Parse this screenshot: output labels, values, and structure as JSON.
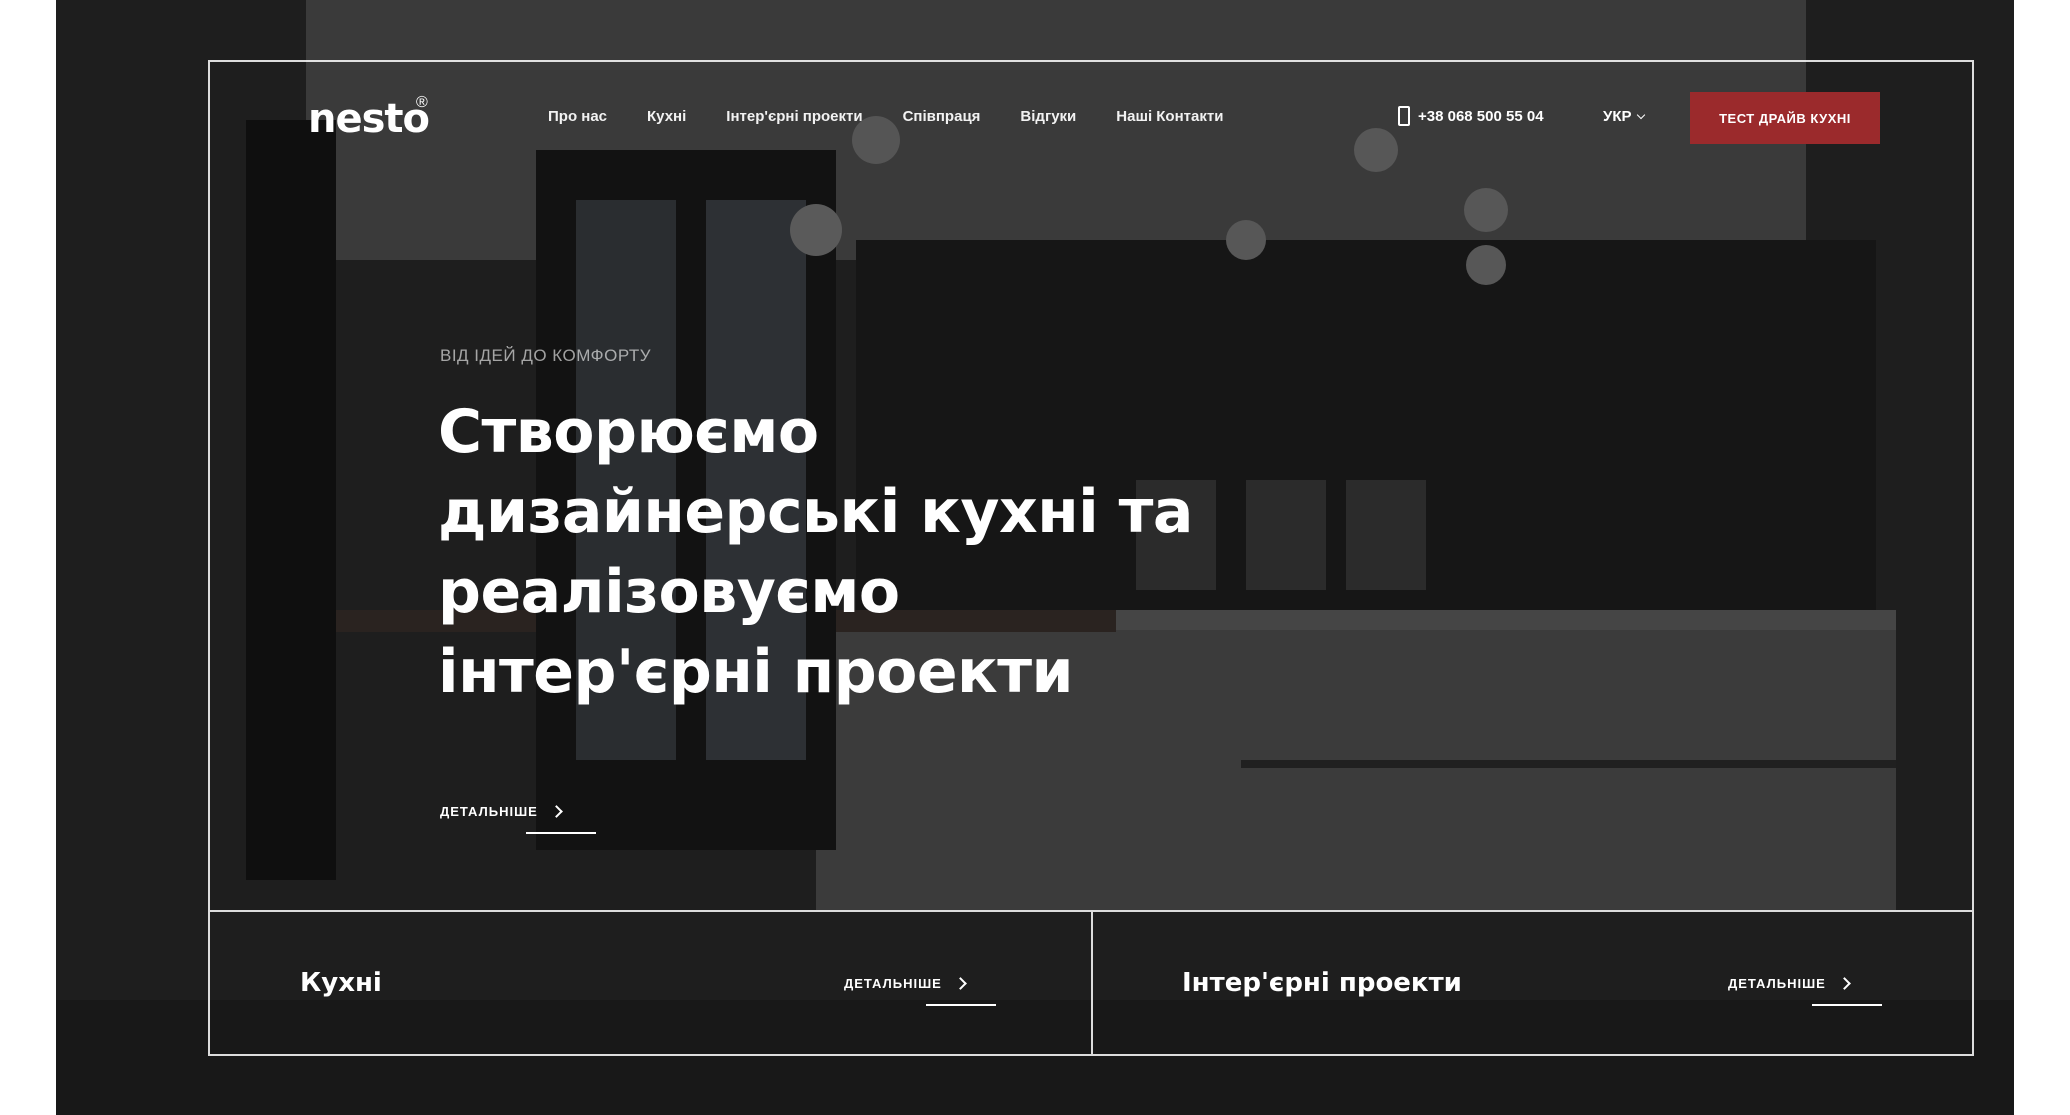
{
  "header": {
    "logo": "nesto",
    "logo_mark": "®",
    "nav": [
      "Про нас",
      "Кухні",
      "Інтер'єрні проекти",
      "Співпраця",
      "Відгуки",
      "Наші Контакти"
    ],
    "phone": "+38 068 500 55 04",
    "phone_icon": "phone-icon",
    "language": "УКР",
    "cta_label": "ТЕСТ ДРАЙВ КУХНІ"
  },
  "hero": {
    "eyebrow": "ВІД ІДЕЙ ДО КОМФОРТУ",
    "title_lines": [
      "Створюємо",
      "дизайнерські кухні та",
      "реалізовуємо",
      "інтер'єрні проекти"
    ],
    "more_label": "ДЕТАЛЬНІШЕ"
  },
  "cards": [
    {
      "title": "Кухні",
      "more_label": "ДЕТАЛЬНІШЕ"
    },
    {
      "title": "Інтер'єрні проекти",
      "more_label": "ДЕТАЛЬНІШЕ"
    }
  ],
  "colors": {
    "accent": "#9b2a2c",
    "text": "#ffffff",
    "backdrop": "#242424"
  }
}
